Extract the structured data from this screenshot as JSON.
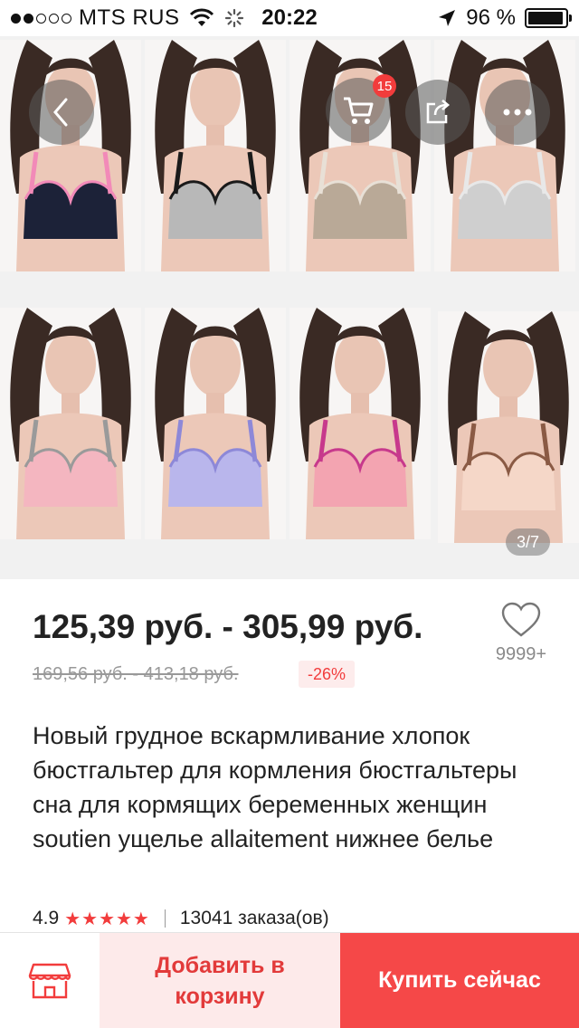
{
  "status_bar": {
    "carrier": "MTS RUS",
    "time": "20:22",
    "battery": "96 %",
    "battery_level": 0.96,
    "signal_bars_filled": 2,
    "signal_bars_total": 5
  },
  "gallery": {
    "cart_count": "15",
    "page_indicator": "3/7",
    "product_colors": [
      "#1c2238",
      "#b8b8b8",
      "#b9a997",
      "#cfcfcf",
      "#f4b6c0",
      "#b9b6ec",
      "#f3a4b1",
      "#f5d7c8"
    ],
    "accent_colors": [
      "#f28ab8",
      "#1a1a1a",
      "#e8e0d6",
      "#e8e8e8",
      "#9a9a9a",
      "#8d88d8",
      "#c7398c",
      "#8a5a44"
    ]
  },
  "product": {
    "price": "125,39 руб. - 305,99 руб.",
    "old_price": "169,56 руб. - 413,18 руб.",
    "discount": "-26%",
    "wishlist_count": "9999+",
    "title": "Новый грудное вскармливание хлопок бюстгальтер для кормления бюстгальтеры сна для кормящих беременных женщин soutien ущелье allaitement нижнее белье",
    "rating": "4.9",
    "stars": "★★★★★",
    "orders": "13041 заказа(ов)"
  },
  "actions": {
    "add_to_cart": "Добавить в корзину",
    "buy_now": "Купить сейчас"
  },
  "colors": {
    "accent_red": "#f23c3c",
    "buy_button": "#f54848",
    "add_cart_bg": "#fdeaea"
  }
}
